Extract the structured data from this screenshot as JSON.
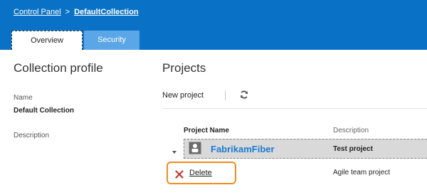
{
  "breadcrumb": {
    "root": "Control Panel",
    "separator": ">",
    "current": "DefaultCollection"
  },
  "tabs": [
    {
      "label": "Overview",
      "selected": true
    },
    {
      "label": "Security",
      "selected": false
    }
  ],
  "collection_profile": {
    "title": "Collection profile",
    "name_label": "Name",
    "name_value": "Default Collection",
    "description_label": "Description"
  },
  "projects": {
    "title": "Projects",
    "new_project_label": "New project",
    "refresh_icon": "refresh-icon",
    "columns": {
      "name": "Project Name",
      "description": "Description"
    },
    "rows": [
      {
        "name": "FabrikamFiber",
        "description": "Test project",
        "icon": "team-project-icon"
      }
    ],
    "context_action": {
      "label": "Delete",
      "icon": "delete-x-icon"
    },
    "second_row_description": "Agile team project"
  },
  "colors": {
    "header_bg": "#0a72c6",
    "tab_inactive_bg": "#5aa6e6",
    "link_blue": "#1a7bd1",
    "highlight_orange": "#f08c1e",
    "delete_red": "#c0392b"
  }
}
